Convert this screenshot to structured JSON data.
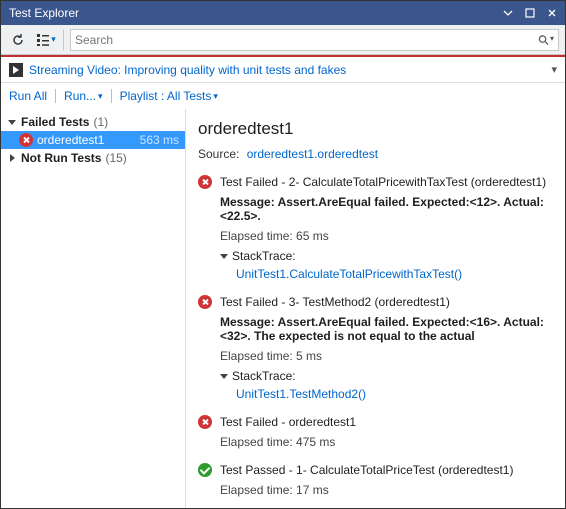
{
  "window": {
    "title": "Test Explorer"
  },
  "search": {
    "placeholder": "Search"
  },
  "video": {
    "linkText": "Streaming Video: Improving quality with unit tests and fakes"
  },
  "commands": {
    "runAll": "Run All",
    "run": "Run...",
    "playlistLabel": "Playlist : All Tests"
  },
  "tree": {
    "failed": {
      "label": "Failed Tests",
      "count": "(1)"
    },
    "failedItem": {
      "name": "orderedtest1",
      "time": "563 ms"
    },
    "notRun": {
      "label": "Not Run Tests",
      "count": "(15)"
    }
  },
  "details": {
    "title": "orderedtest1",
    "sourceLabel": "Source:",
    "sourceLink": "orderedtest1.orderedtest",
    "results": [
      {
        "status": "fail",
        "title": "Test Failed - 2- CalculateTotalPricewithTaxTest (orderedtest1)",
        "message": "Message: Assert.AreEqual failed. Expected:<12>. Actual:<22.5>.",
        "elapsed": "Elapsed time: 65 ms",
        "stackLabel": "StackTrace:",
        "stackLink": "UnitTest1.CalculateTotalPricewithTaxTest()"
      },
      {
        "status": "fail",
        "title": "Test Failed - 3- TestMethod2 (orderedtest1)",
        "message": "Message: Assert.AreEqual failed. Expected:<16>. Actual:<32>. The expected is not equal to the actual",
        "elapsed": "Elapsed time: 5 ms",
        "stackLabel": "StackTrace:",
        "stackLink": "UnitTest1.TestMethod2()"
      },
      {
        "status": "fail",
        "title": "Test Failed - orderedtest1",
        "elapsed": "Elapsed time: 475 ms"
      },
      {
        "status": "pass",
        "title": "Test Passed - 1- CalculateTotalPriceTest (orderedtest1)",
        "elapsed": "Elapsed time: 17 ms"
      }
    ]
  }
}
